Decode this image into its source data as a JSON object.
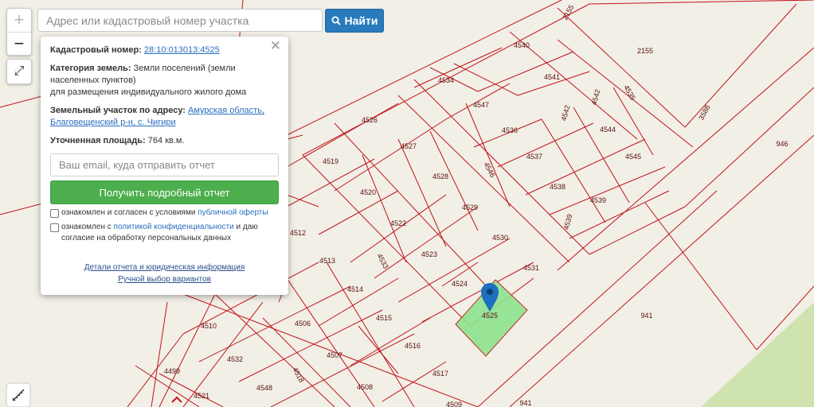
{
  "search": {
    "placeholder": "Адрес или кадастровый номер участка",
    "button_label": "Найти"
  },
  "zoom": {
    "in_label": "+",
    "out_label": "−"
  },
  "popup": {
    "cadastral_label": "Кадастровый номер:",
    "cadastral_value": "28:10:013013:4525",
    "land_category_label": "Категория земель:",
    "land_category_value": "Земли поселений (земли населенных пунктов)",
    "land_use_value": "для размещения индивидуального жилого дома",
    "address_label": "Земельный участок по адресу:",
    "address_value": "Амурская область, Благовещенский р-н, с. Чигири",
    "area_label": "Уточненная площадь:",
    "area_value": "764 кв.м.",
    "email_placeholder": "Ваш email, куда отправить отчет",
    "report_button": "Получить подробный отчет",
    "consent_offer_text": "ознакомлен и согласен с условиями",
    "consent_offer_link": "публичной оферты",
    "consent_privacy_text": "ознакомлен с",
    "consent_privacy_link": "политикой конфиденциальности",
    "consent_privacy_text2": "и даю согласие на обработку персональных данных",
    "details_link": "Детали отчета и юридическая информация",
    "manual_link": "Ручной выбор вариантов"
  },
  "map": {
    "parcel_labels": [
      "4540",
      "2155",
      "2155",
      "4534",
      "4541",
      "4535",
      "4547",
      "4542",
      "4542",
      "3588",
      "4544",
      "4536",
      "4526",
      "4527",
      "4537",
      "4545",
      "946",
      "4519",
      "4528",
      "4546",
      "4538",
      "4520",
      "4539",
      "4539",
      "4529",
      "4522",
      "4512",
      "4530",
      "4523",
      "4513",
      "4533",
      "4531",
      "4524",
      "4514",
      "4525",
      "941",
      "4515",
      "4506",
      "4510",
      "4516",
      "4532",
      "4507",
      "4517",
      "4499",
      "4518",
      "4508",
      "4548",
      "4521",
      "941",
      "4509"
    ],
    "selected_parcel": "4525",
    "colors": {
      "background": "#f2efe6",
      "green_area": "#cfe3b0",
      "parcel_line": "#c0141c",
      "selected_fill": "#8fe38f",
      "marker": "#1f6fbf"
    }
  }
}
